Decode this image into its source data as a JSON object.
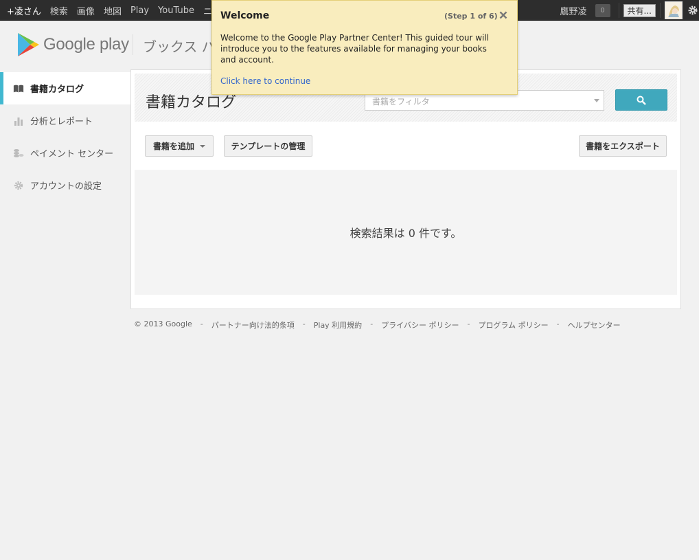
{
  "gbar": {
    "links": [
      "+凌さん",
      "検索",
      "画像",
      "地図",
      "Play",
      "YouTube",
      "ニュ"
    ],
    "user_name": "鷹野凌",
    "notification_count": "0",
    "share_label": "共有..."
  },
  "header": {
    "logo_text": "Google play",
    "product_name": "ブックス パー"
  },
  "sidebar": {
    "items": [
      {
        "label": "書籍カタログ",
        "icon": "book-icon"
      },
      {
        "label": "分析とレポート",
        "icon": "bar-chart-icon"
      },
      {
        "label": "ペイメント センター",
        "icon": "coins-icon"
      },
      {
        "label": "アカウントの設定",
        "icon": "gear-icon"
      }
    ]
  },
  "main": {
    "title": "書籍カタログ",
    "filter_placeholder": "書籍をフィルタ",
    "add_book_label": "書籍を追加",
    "manage_templates_label": "テンプレートの管理",
    "export_label": "書籍をエクスポート",
    "results_text": "検索結果は 0 件です。"
  },
  "footer": {
    "items": [
      "© 2013 Google",
      "パートナー向け法的条項",
      "Play 利用規約",
      "プライバシー ポリシー",
      "プログラム ポリシー",
      "ヘルプセンター"
    ],
    "separator": "-"
  },
  "tour": {
    "title": "Welcome",
    "step": "(Step 1 of 6)",
    "body": "Welcome to the Google Play Partner Center! This guided tour will introduce you to the features available for managing your books and account.",
    "link": "Click here to continue"
  },
  "colors": {
    "accent": "#41b8d0",
    "search_button": "#40a8bd",
    "tour_bg": "#f9edbe",
    "link": "#3366cc"
  }
}
